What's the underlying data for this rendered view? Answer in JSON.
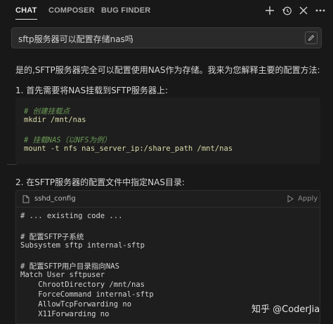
{
  "tabs": [
    {
      "label": "CHAT",
      "active": true
    },
    {
      "label": "COMPOSER",
      "active": false
    },
    {
      "label": "BUG FINDER",
      "active": false
    }
  ],
  "toolbar_icons": [
    "plus-icon",
    "history-icon",
    "close-icon",
    "more-icon"
  ],
  "question": {
    "text": "sftp服务器可以配置存储nas吗"
  },
  "answer": {
    "intro": "是的,SFTP服务器完全可以配置使用NAS作为存储。我来为您解释主要的配置方法:",
    "step1": "1. 首先需要将NAS挂载到SFTP服务器上:",
    "code1": {
      "lines": [
        {
          "text": "# 创建挂载点",
          "kind": "comment"
        },
        {
          "text": "mkdir /mnt/nas",
          "kind": "cmd"
        },
        {
          "text": "",
          "kind": "plain"
        },
        {
          "text": "# 挂载NAS（以NFS为例）",
          "kind": "comment"
        },
        {
          "text": "mount -t nfs nas_server_ip:/share_path /mnt/nas",
          "kind": "cmd"
        }
      ]
    },
    "step2": "2. 在SFTP服务器的配置文件中指定NAS目录:",
    "code2": {
      "file_name": "sshd_config",
      "apply_label": "Apply",
      "lines": [
        "# ... existing code ...",
        "",
        "# 配置SFTP子系统",
        "Subsystem sftp internal-sftp",
        "",
        "# 配置SFTP用户目录指向NAS",
        "Match User sftpuser",
        "    ChrootDirectory /mnt/nas",
        "    ForceCommand internal-sftp",
        "    AllowTcpForwarding no",
        "    X11Forwarding no"
      ]
    }
  },
  "watermark": "知乎 @CoderJia"
}
